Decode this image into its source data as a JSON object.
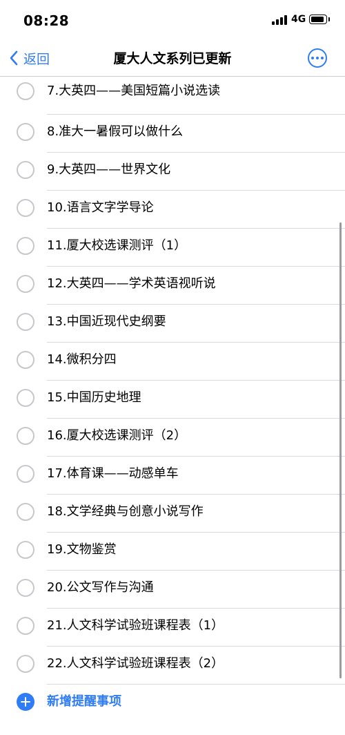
{
  "status_bar": {
    "time": "08:28",
    "network": "4G"
  },
  "nav": {
    "back_label": "返回",
    "title": "厦大人文系列已更新"
  },
  "items": [
    {
      "label": "7.大英四——美国短篇小说选读"
    },
    {
      "label": "8.准大一暑假可以做什么"
    },
    {
      "label": "9.大英四——世界文化"
    },
    {
      "label": "10.语言文字学导论"
    },
    {
      "label": "11.厦大校选课测评（1）"
    },
    {
      "label": "12.大英四——学术英语视听说"
    },
    {
      "label": "13.中国近现代史纲要"
    },
    {
      "label": "14.微积分四"
    },
    {
      "label": "15.中国历史地理"
    },
    {
      "label": "16.厦大校选课测评（2）"
    },
    {
      "label": "17.体育课——动感单车"
    },
    {
      "label": "18.文学经典与创意小说写作"
    },
    {
      "label": "19.文物鉴赏"
    },
    {
      "label": "20.公文写作与沟通"
    },
    {
      "label": "21.人文科学试验班课程表（1）"
    },
    {
      "label": "22.人文科学试验班课程表（2）"
    }
  ],
  "add_reminder": {
    "label": "新增提醒事项"
  },
  "colors": {
    "accent": "#2f7cf6",
    "checkbox_border": "#c7c7cc",
    "divider": "#d9d9dc"
  }
}
